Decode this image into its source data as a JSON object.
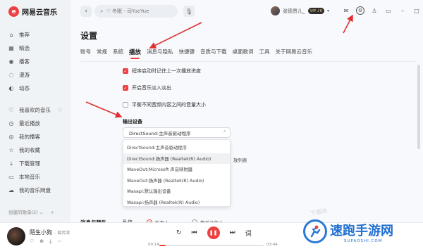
{
  "app": {
    "logo_text": "网易云音乐",
    "logo_mark": "e"
  },
  "sidebar": {
    "items": [
      {
        "icon": "home-icon",
        "glyph": "⌂",
        "label": "推荐"
      },
      {
        "icon": "grid-icon",
        "glyph": "▦",
        "label": "精选"
      },
      {
        "icon": "radio-icon",
        "glyph": "◉",
        "label": "播客"
      },
      {
        "icon": "roam-icon",
        "glyph": "◌",
        "label": "漫游"
      },
      {
        "icon": "feed-icon",
        "glyph": "◐",
        "label": "动态"
      }
    ],
    "my_items": [
      {
        "icon": "heart-icon",
        "glyph": "♡",
        "label": "我喜欢的音乐"
      },
      {
        "icon": "recent-icon",
        "glyph": "◷",
        "label": "最近播放"
      },
      {
        "icon": "podcast-icon",
        "glyph": "◎",
        "label": "我的播客"
      },
      {
        "icon": "star-icon",
        "glyph": "☆",
        "label": "我的收藏"
      },
      {
        "icon": "download-icon",
        "glyph": "⤓",
        "label": "下载管理"
      },
      {
        "icon": "local-music-icon",
        "glyph": "▭",
        "label": "本地音乐"
      },
      {
        "icon": "cloud-icon",
        "glyph": "☁",
        "label": "我的音乐网盘"
      }
    ],
    "created_playlists": "创建的歌单(2)"
  },
  "topbar": {
    "search_placeholder": "♡ 冬眠 - 司YueYue",
    "username": "张德贵儿_",
    "vip": "VIP ♪6"
  },
  "settings": {
    "title": "设置",
    "tabs": [
      "账号",
      "常规",
      "系统",
      "播放",
      "消息与隐私",
      "快捷键",
      "音质与下载",
      "桌面歌词",
      "工具",
      "关于网易云音乐"
    ],
    "active_tab": "播放",
    "checkboxes": [
      {
        "label": "程序启动时记住上一次播放进度",
        "checked": true
      },
      {
        "label": "开启音乐淡入淡出",
        "checked": true
      },
      {
        "label": "平衡不同音频内容之间的音量大小",
        "checked": false
      }
    ],
    "output_label": "输出设备",
    "output_selected": "DirectSound:主声音驱动程序",
    "output_options": [
      "DirectSound:主声音驱动程序",
      "DirectSound:扬声器 (Realtek(R) Audio)",
      "WaveOut:Microsoft 声音映射器",
      "WaveOut:扬声器 (Realtek(R) Audio)",
      "Wasapi:默认输出设备",
      "Wasapi:扬声器 (Realtek(R) Audio)"
    ],
    "obscured_text": "放列表",
    "privacy_section": "消息与隐私",
    "privacy_key": "私信",
    "privacy_option_all": "所有人",
    "privacy_option_following": "我关注的人"
  },
  "player": {
    "title": "陌生小狗",
    "artist": "- 曾羿淇",
    "time_current": "00:14",
    "time_total": "03:44",
    "progress": 0.06,
    "lyrics_label": "词"
  },
  "watermark": {
    "text": "速跑手游网",
    "sub": "SUPAOSHI.COM",
    "faint": "下载站"
  },
  "colors": {
    "accent": "#ec4141",
    "annotation": "#e03030",
    "watermark": "#1f6fd1"
  }
}
